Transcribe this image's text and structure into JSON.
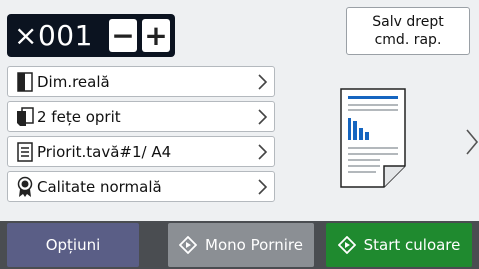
{
  "copies": {
    "value": "×001",
    "minus_label": "−",
    "plus_label": "+"
  },
  "shortcut": {
    "line1": "Salv drept",
    "line2": "cmd. rap."
  },
  "settings": [
    {
      "icon": "page-size-icon",
      "label": "Dim.reală"
    },
    {
      "icon": "duplex-icon",
      "label": "2 fețe oprit"
    },
    {
      "icon": "tray-priority-icon",
      "label": "Priorit.tavă#1/ A4"
    },
    {
      "icon": "quality-ribbon-icon",
      "label": "Calitate normală"
    }
  ],
  "bottom": {
    "options_label": "Opțiuni",
    "mono_label": "Mono Pornire",
    "color_label": "Start culoare"
  },
  "colors": {
    "accent_blue": "#1565c0",
    "options_bg": "#5a5e86",
    "mono_bg": "#8b8f94",
    "color_bg": "#1f8a2f",
    "counter_bg": "#0b1320"
  }
}
